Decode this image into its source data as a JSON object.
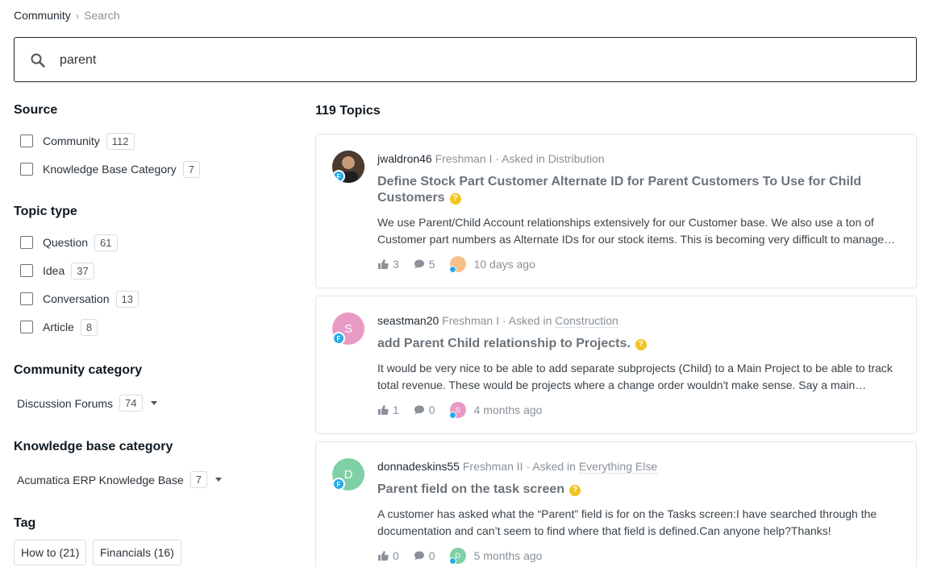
{
  "breadcrumb": {
    "root": "Community",
    "separator": "›",
    "current": "Search"
  },
  "search": {
    "value": "parent",
    "placeholder": ""
  },
  "sidebar": {
    "source_title": "Source",
    "source_items": [
      {
        "label": "Community",
        "count": "112"
      },
      {
        "label": "Knowledge Base Category",
        "count": "7"
      }
    ],
    "topic_type_title": "Topic type",
    "topic_type_items": [
      {
        "label": "Question",
        "count": "61"
      },
      {
        "label": "Idea",
        "count": "37"
      },
      {
        "label": "Conversation",
        "count": "13"
      },
      {
        "label": "Article",
        "count": "8"
      }
    ],
    "community_category_title": "Community category",
    "community_category": {
      "label": "Discussion Forums",
      "count": "74"
    },
    "kb_category_title": "Knowledge base category",
    "kb_category": {
      "label": "Acumatica ERP Knowledge Base",
      "count": "7"
    },
    "tag_title": "Tag",
    "tags": [
      "How to (21)",
      "Financials (16)"
    ]
  },
  "results": {
    "title": "119 Topics",
    "items": [
      {
        "username": "jwaldron46",
        "rank": "Freshman I",
        "asked_in": "· Asked in",
        "category": "Distribution",
        "title": "Define Stock Part Customer Alternate ID for Parent Customers To Use for Child Customers",
        "excerpt": "We use Parent/Child Account relationships extensively for our Customer base.  We also use a ton of Customer part numbers as Alternate IDs for our stock items.  This is becoming very difficult to manage…",
        "likes": "3",
        "comments": "5",
        "last_avatar_letter": "",
        "time": "10 days ago",
        "avatar_letter": "",
        "avatar_color": "#3a2a22",
        "last_avatar_color": "#f7c08a"
      },
      {
        "username": "seastman20",
        "rank": "Freshman I",
        "asked_in": "· Asked in",
        "category": "Construction",
        "title": "add Parent Child relationship to Projects.",
        "excerpt": "It would be very nice to be able to add separate subprojects (Child) to a Main Project to be able to track total revenue.  These would be projects where a change order wouldn't make sense.  Say a main…",
        "likes": "1",
        "comments": "0",
        "last_avatar_letter": "S",
        "time": "4 months ago",
        "avatar_letter": "S",
        "avatar_color": "#e99ac4",
        "last_avatar_color": "#e99ac4"
      },
      {
        "username": "donnadeskins55",
        "rank": "Freshman II",
        "asked_in": "· Asked in",
        "category": "Everything Else",
        "title": "Parent field on the task screen",
        "excerpt": "A customer has asked what the “Parent” field is for on the Tasks screen:I have searched through the documentation and can’t seem to find where that field is defined.Can anyone help?Thanks!",
        "likes": "0",
        "comments": "0",
        "last_avatar_letter": "D",
        "time": "5 months ago",
        "avatar_letter": "D",
        "avatar_color": "#7fd0a6",
        "last_avatar_color": "#7fd0a6"
      }
    ]
  },
  "icons": {
    "search": "search-icon",
    "like": "thumbs-up-icon",
    "comment": "comment-icon",
    "question": "question-icon",
    "rank": "rank-badge-icon"
  }
}
